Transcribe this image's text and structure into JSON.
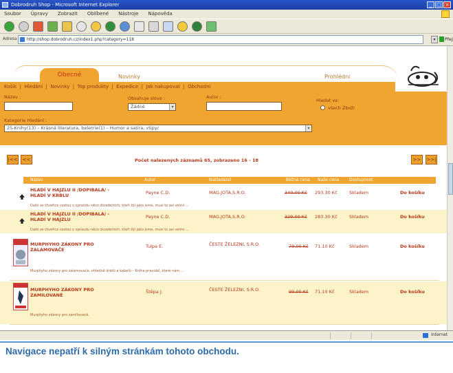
{
  "window": {
    "title": "Dobrodruh Shop - Microsoft Internet Explorer",
    "controls": [
      "_",
      "□",
      "×"
    ]
  },
  "menubar": [
    "Soubor",
    "Úpravy",
    "Zobrazit",
    "Oblíbené",
    "Nástroje",
    "Nápověda"
  ],
  "toolbar_icons": [
    "back-icon",
    "forward-icon",
    "stop-icon",
    "refresh-icon",
    "home-icon",
    "search-icon",
    "favorites-icon",
    "media-icon",
    "history-icon",
    "mail-icon",
    "print-icon",
    "edit-icon",
    "folder-icon",
    "messenger-icon",
    "msn-icon"
  ],
  "address": {
    "label": "Adresa",
    "url": "http://shop.dobrodruh.cz/index1.php?category=118",
    "go_label": "Přejít"
  },
  "site": {
    "tabs": [
      {
        "label": "Obecné",
        "active": true
      },
      {
        "label": "Novinky",
        "active": false
      },
      {
        "label": "Prohlédni",
        "active": false
      }
    ],
    "nav": [
      "Košík",
      "Hledání",
      "Novinky",
      "Top produkty",
      "Expedice",
      "Jak nakupovat",
      "Obchodní"
    ],
    "search": {
      "title_label": "Název :",
      "tags_label": "Obsahuje slovo :",
      "tags_value": "Žádné",
      "author_label": "Autor :",
      "scope_label": "Hledat ve:",
      "scope_option": "všech Zboží",
      "category_label": "Kategorie Hledání :",
      "category_value": "25-Knihy(13) – Krásná literatura, beletrie(1) – Humor a satira, vtipy/"
    },
    "pager": {
      "text": "Počet nalezených záznamů 65, zobrazeno 16 - 18",
      "first": "|<<",
      "prev": "<<",
      "next": ">>",
      "last": ">>|"
    },
    "columns": [
      "Název",
      "Autor",
      "Nakladatel",
      "Běžná cena",
      "Naše cena",
      "Dostupnost",
      ""
    ],
    "rows": [
      {
        "title": "HLADÍ V HAJZLU II /DOPIBALA/ - HLADÍ V KRBLU",
        "author": "Payne C.D.",
        "publisher": "MAG.JOTA,S.R.O.",
        "old_price": "340.00 Kč",
        "price": "293.30 Kč",
        "availability": "Skladem",
        "action": "Do košíku",
        "description": "Další ze čtveřice cestou v opravdu něco divadelních, kteří žijí jako jsme, musí to asi velmi ..."
      },
      {
        "title": "HLADÍ V HAJZLU II /DOPIBALA/ - HLADÍ V HAJZLU",
        "author": "Payne C.D.",
        "publisher": "MAG.JOTA,S.R.O.",
        "old_price": "329.00 Kč",
        "price": "283.30 Kč",
        "availability": "Skladem",
        "action": "Do košíku",
        "description": "Další ze čtveřice cestou v opravdu něco divadelních, kteří žijí jako jsme, musí to asi velmi ..."
      },
      {
        "title": "MURPHYHO ZÁKONY PRO ZALAMOVAČE",
        "author": "Tulpa E.",
        "publisher": "ČESTE ŽELEZNI, S.R.O.",
        "old_price": "79.00 Kč",
        "price": "71.10 Kč",
        "availability": "Skladem",
        "action": "Do košíku",
        "description": "Murphyho zákony pro zalamovače, ohledně drátů a kabelů – Kniha pravidel, které nám ..."
      },
      {
        "title": "MURPHYHO ZÁKONY PRO ZAMILOVANÉ",
        "author": "Štěpa J.",
        "publisher": "ČESTE ŽELEZNI, S.R.O.",
        "old_price": "99.00 Kč",
        "price": "71.10 Kč",
        "availability": "Skladem",
        "action": "Do košíku",
        "description": "Murphyho zákony pro zamilované."
      }
    ]
  },
  "status": {
    "zone": "Internet"
  },
  "caption": "Navigace nepatří k silným stránkám tohoto obchodu.",
  "colors": {
    "accent": "#f0a530",
    "title_red": "#b5371a",
    "caption_blue": "#2d6ba8"
  }
}
